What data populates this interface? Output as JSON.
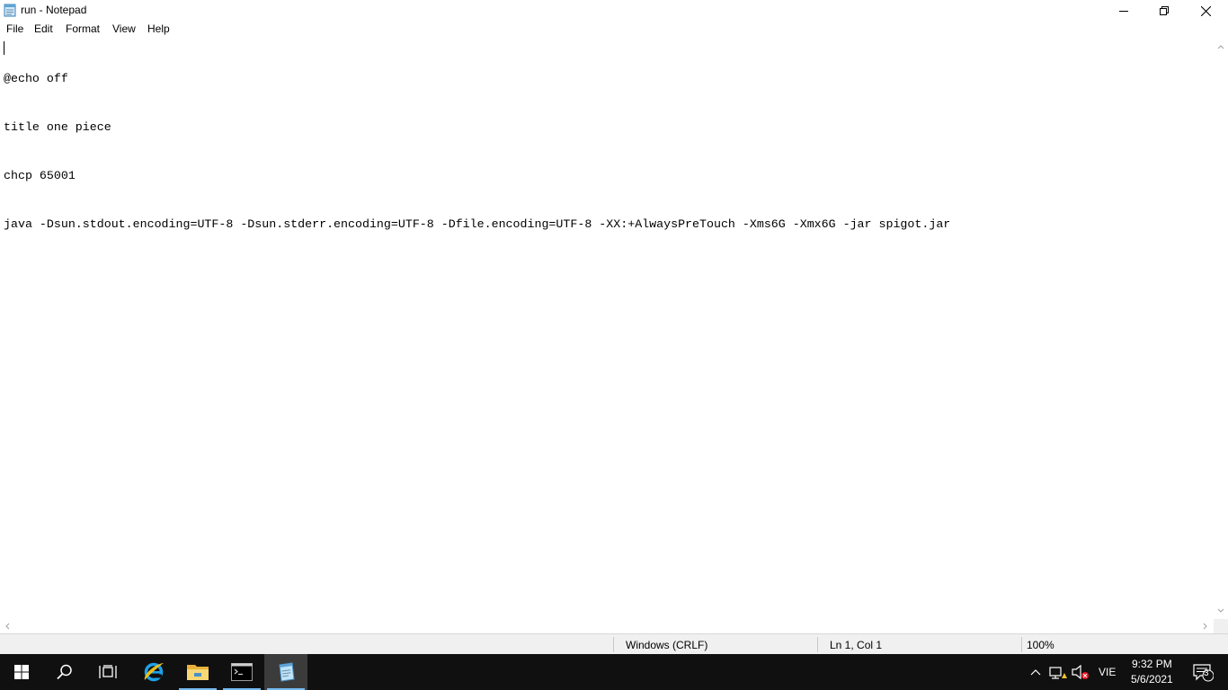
{
  "window": {
    "title": "run - Notepad"
  },
  "menu": {
    "items": [
      "File",
      "Edit",
      "Format",
      "View",
      "Help"
    ]
  },
  "editor": {
    "lines": [
      "@echo off",
      "title one piece",
      "chcp 65001",
      "java -Dsun.stdout.encoding=UTF-8 -Dsun.stderr.encoding=UTF-8 -Dfile.encoding=UTF-8 -XX:+AlwaysPreTouch -Xms6G -Xmx6G -jar spigot.jar"
    ]
  },
  "status": {
    "line_ending": "Windows (CRLF)",
    "position": "Ln 1, Col 1",
    "zoom": "100%"
  },
  "taskbar": {
    "apps": [
      {
        "icon": "internet-explorer-icon"
      },
      {
        "icon": "file-explorer-icon"
      },
      {
        "icon": "command-prompt-icon"
      },
      {
        "icon": "notepad-icon"
      }
    ],
    "tray": {
      "language": "VIE",
      "time": "9:32 PM",
      "date": "5/6/2021",
      "notifications": "3"
    }
  },
  "colors": {
    "taskbar": "#101010",
    "accent": "#76b9ed",
    "statusbar": "#f0f0f0"
  }
}
